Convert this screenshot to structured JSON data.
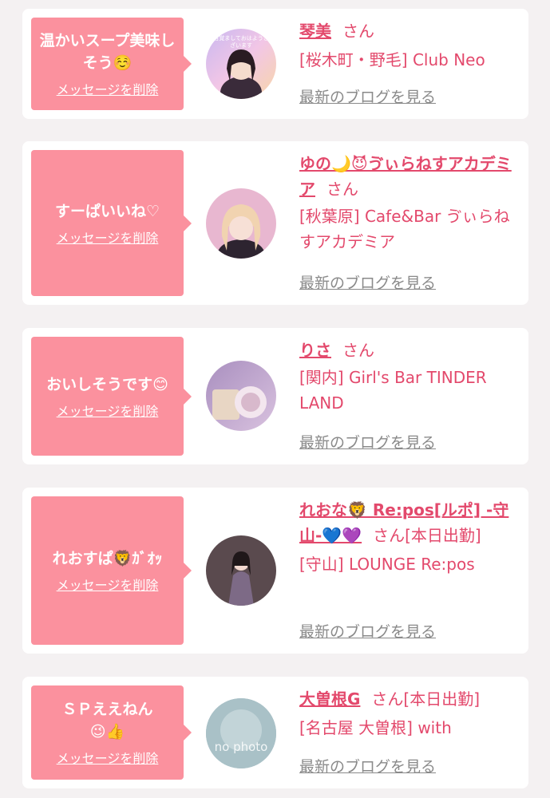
{
  "colors": {
    "background": "#f4f1f2",
    "card": "#ffffff",
    "bubble": "#fb919e",
    "accent": "#e3496c",
    "link_gray": "#8a8a8a"
  },
  "delete_label": "メッセージを削除",
  "blog_label": "最新のブログを見る",
  "entries": [
    {
      "message": "温かいスープ美味しそう☺️",
      "name": "琴美",
      "honorific": "さん",
      "shop": "[桜木町・野毛] Club Neo",
      "avatar_text": "目覚ましておはようございます"
    },
    {
      "message": "すーぱいいね♡",
      "name": "ゆの🌙😈ゔぃらねすアカデミア",
      "honorific": "さん",
      "shop": "[秋葉原] Cafe&Bar ゔぃらねすアカデミア"
    },
    {
      "message": "おいしそうです😊",
      "name": "りさ",
      "honorific": "さん",
      "shop": "[関内] Girl's Bar TINDER LAND"
    },
    {
      "message": "れおすぱ🦁ｶﾞｵｯ",
      "name": "れおな🦁 Re:pos[ルポ] -守山-💙💜",
      "honorific": "さん[本日出勤]",
      "shop": "[守山] LOUNGE Re:pos"
    },
    {
      "message": "ＳＰええねん😉👍",
      "name": "大曽根G",
      "honorific": "さん[本日出勤]",
      "shop": "[名古屋 大曽根] with",
      "avatar_text": "no photo"
    }
  ]
}
